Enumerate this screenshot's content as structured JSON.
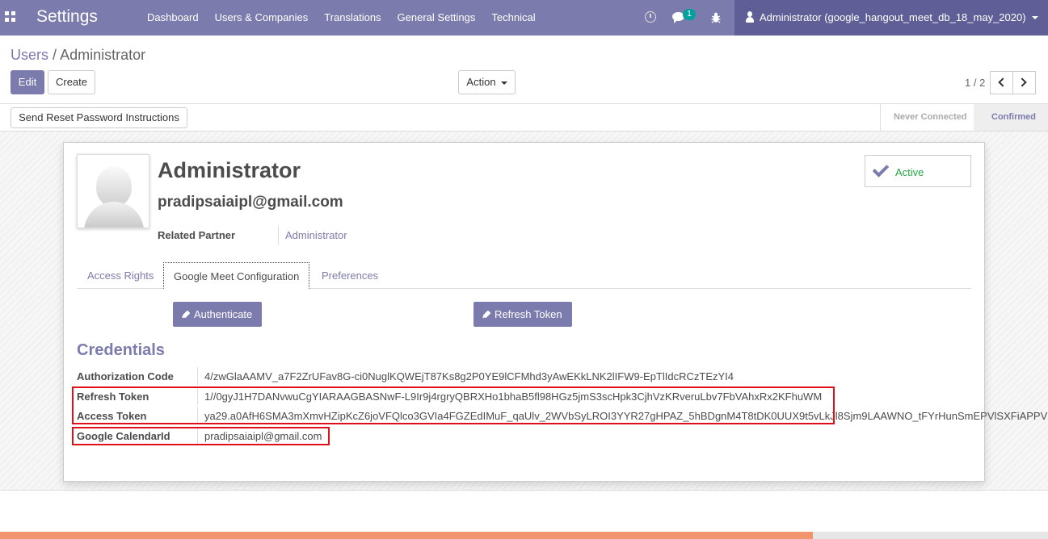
{
  "navbar": {
    "app_title": "Settings",
    "menu": [
      "Dashboard",
      "Users & Companies",
      "Translations",
      "General Settings",
      "Technical"
    ],
    "chat_badge": "1",
    "user": "Administrator (google_hangout_meet_db_18_may_2020)",
    "icons": [
      "apps-grid-icon",
      "clock-icon",
      "chat-icon",
      "bug-icon",
      "user-icon"
    ]
  },
  "breadcrumb": {
    "parent": "Users",
    "separator": "/",
    "current": "Administrator"
  },
  "controls": {
    "edit": "Edit",
    "create": "Create",
    "action": "Action",
    "pager": "1 / 2"
  },
  "statusbar": {
    "reset_button": "Send Reset Password Instructions",
    "stages": [
      "Never Connected",
      "Confirmed"
    ],
    "current_stage": "Confirmed"
  },
  "form": {
    "name": "Administrator",
    "login": "pradipsaiaipl@gmail.com",
    "related_partner_label": "Related Partner",
    "related_partner_value": "Administrator",
    "active_label": "Active",
    "tabs": [
      "Access Rights",
      "Google Meet Configuration",
      "Preferences"
    ],
    "active_tab": "Google Meet Configuration",
    "authenticate_label": "Authenticate",
    "refresh_label": "Refresh Token",
    "credentials_title": "Credentials",
    "fields": {
      "auth_code": {
        "label": "Authorization Code",
        "value": "4/zwGlaAAMV_a7F2ZrUFav8G-ci0NuglKQWEjT87Ks8g2P0YE9lCFMhd3yAwEKkLNK2lIFW9-EpTlIdcRCzTEzYI4"
      },
      "refresh_token": {
        "label": "Refresh Token",
        "value": "1//0gyJ1H7DANvwuCgYIARAAGBASNwF-L9Ir9j4rgryQBRXHo1bhaB5fl98HGz5jmS3scHpk3CjhVzKRveruLbv7FbVAhxRx2KFhuWM"
      },
      "access_token": {
        "label": "Access Token",
        "value": "ya29.a0AfH6SMA3mXmvHZipKcZ6joVFQlco3GVIa4FGZEdIMuF_qaUlv_2WVbSyLROI3YYR27gHPAZ_5hBDgnM4T8tDK0UUX9t5vLkJl8Sjm9LAAWNO_tFYrHunSmEPVlSXFiAPPV"
      },
      "calendar_id": {
        "label": "Google CalendarId",
        "value": "pradipsaiaipl@gmail.com"
      }
    }
  },
  "colors": {
    "brand": "#7c7bad",
    "highlight": "#e0101a",
    "active_green": "#28a745",
    "progress": "#f0956e"
  },
  "progress_fraction": 0.776
}
